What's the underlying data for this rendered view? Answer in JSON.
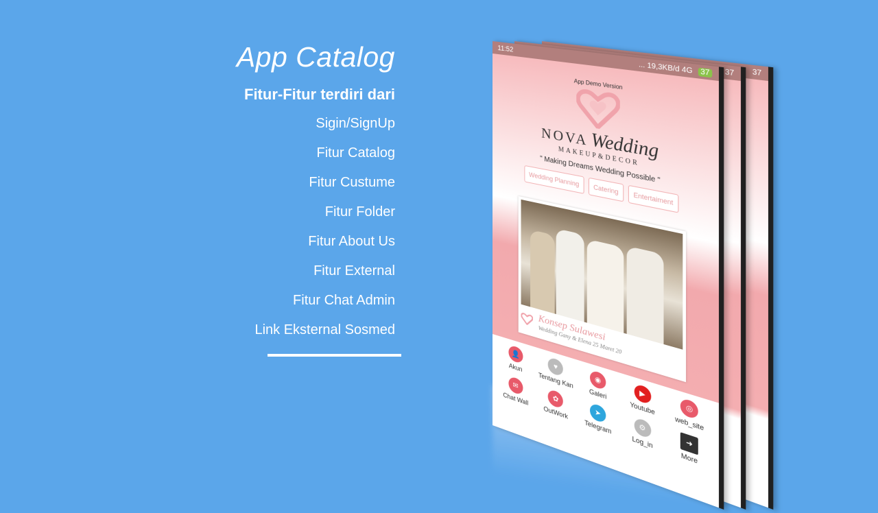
{
  "slide": {
    "title": "App Catalog",
    "subtitle": "Fitur-Fitur terdiri dari",
    "features": [
      "Sigin/SignUp",
      "Fitur Catalog",
      "Fitur Custume",
      "Fitur Folder",
      "Fitur About Us",
      "Fitur External",
      "Fitur Chat Admin",
      "Link Eksternal Sosmed"
    ]
  },
  "phone": {
    "status_time": "11:52",
    "status_right": "... 19,3KB/d 4G",
    "battery": "37",
    "demo": "App Demo Version",
    "brand": "NOVA",
    "brand_script": "Wedding",
    "brand_sub": "MAKEUP&DECOR",
    "tagline": "\" Making Dreams Wedding Possible \"",
    "chips": [
      "Wedding Planning",
      "Catering",
      "Entertaiment"
    ],
    "caption_title": "Konsep Sulawesi",
    "caption_sub": "Wedding Gany & Elena 25 Maret 20",
    "menu": [
      {
        "label": "Akun",
        "color": "#e85a6a"
      },
      {
        "label": "Tentang Kan",
        "color": "#bbbbbb"
      },
      {
        "label": "Galeri",
        "color": "#e85a6a"
      },
      {
        "label": "Youtube",
        "color": "#e22020"
      },
      {
        "label": "web_site",
        "color": "#e85a6a"
      },
      {
        "label": "Chat Wall",
        "color": "#e85a6a"
      },
      {
        "label": "OutWork",
        "color": "#e85a6a"
      },
      {
        "label": "Telegram",
        "color": "#2ea6dd"
      },
      {
        "label": "Log_in",
        "color": "#bbbbbb"
      },
      {
        "label": "More",
        "color": "#333333"
      }
    ],
    "back_menu": [
      "web_site",
      "More"
    ]
  }
}
